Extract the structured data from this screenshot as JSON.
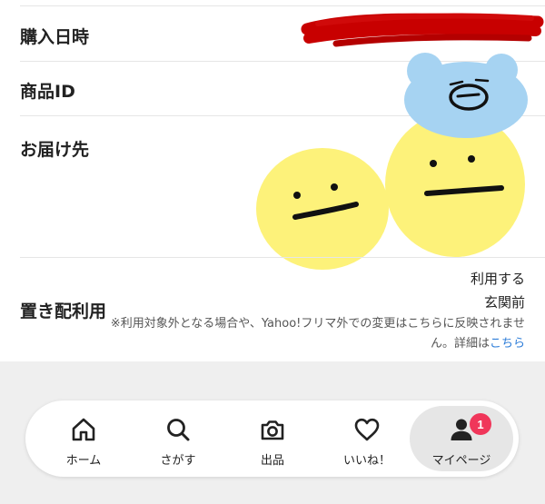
{
  "details": {
    "rows": [
      {
        "label": "購入日時"
      },
      {
        "label": "商品ID"
      },
      {
        "label": "お届け先"
      },
      {
        "label": "置き配利用"
      }
    ],
    "placement": {
      "line1": "利用する",
      "line2": "玄関前",
      "note_text": "※利用対象外となる場合や、Yahoo!フリマ外での変更はこちらに反映されません。詳細は",
      "note_link": "こちら"
    }
  },
  "tabbar": {
    "tabs": [
      {
        "label": "ホーム",
        "icon": "home-icon"
      },
      {
        "label": "さがす",
        "icon": "search-icon"
      },
      {
        "label": "出品",
        "icon": "camera-icon"
      },
      {
        "label": "いいね！",
        "icon": "heart-icon"
      },
      {
        "label": "マイページ",
        "icon": "person-icon",
        "badge": "1",
        "active": true
      }
    ]
  },
  "colors": {
    "redaction": "#c80000",
    "doodle_yellow": "#fdf27a",
    "doodle_blue": "#a6d3f2",
    "badge": "#f0365a",
    "link": "#2a7bd8"
  }
}
